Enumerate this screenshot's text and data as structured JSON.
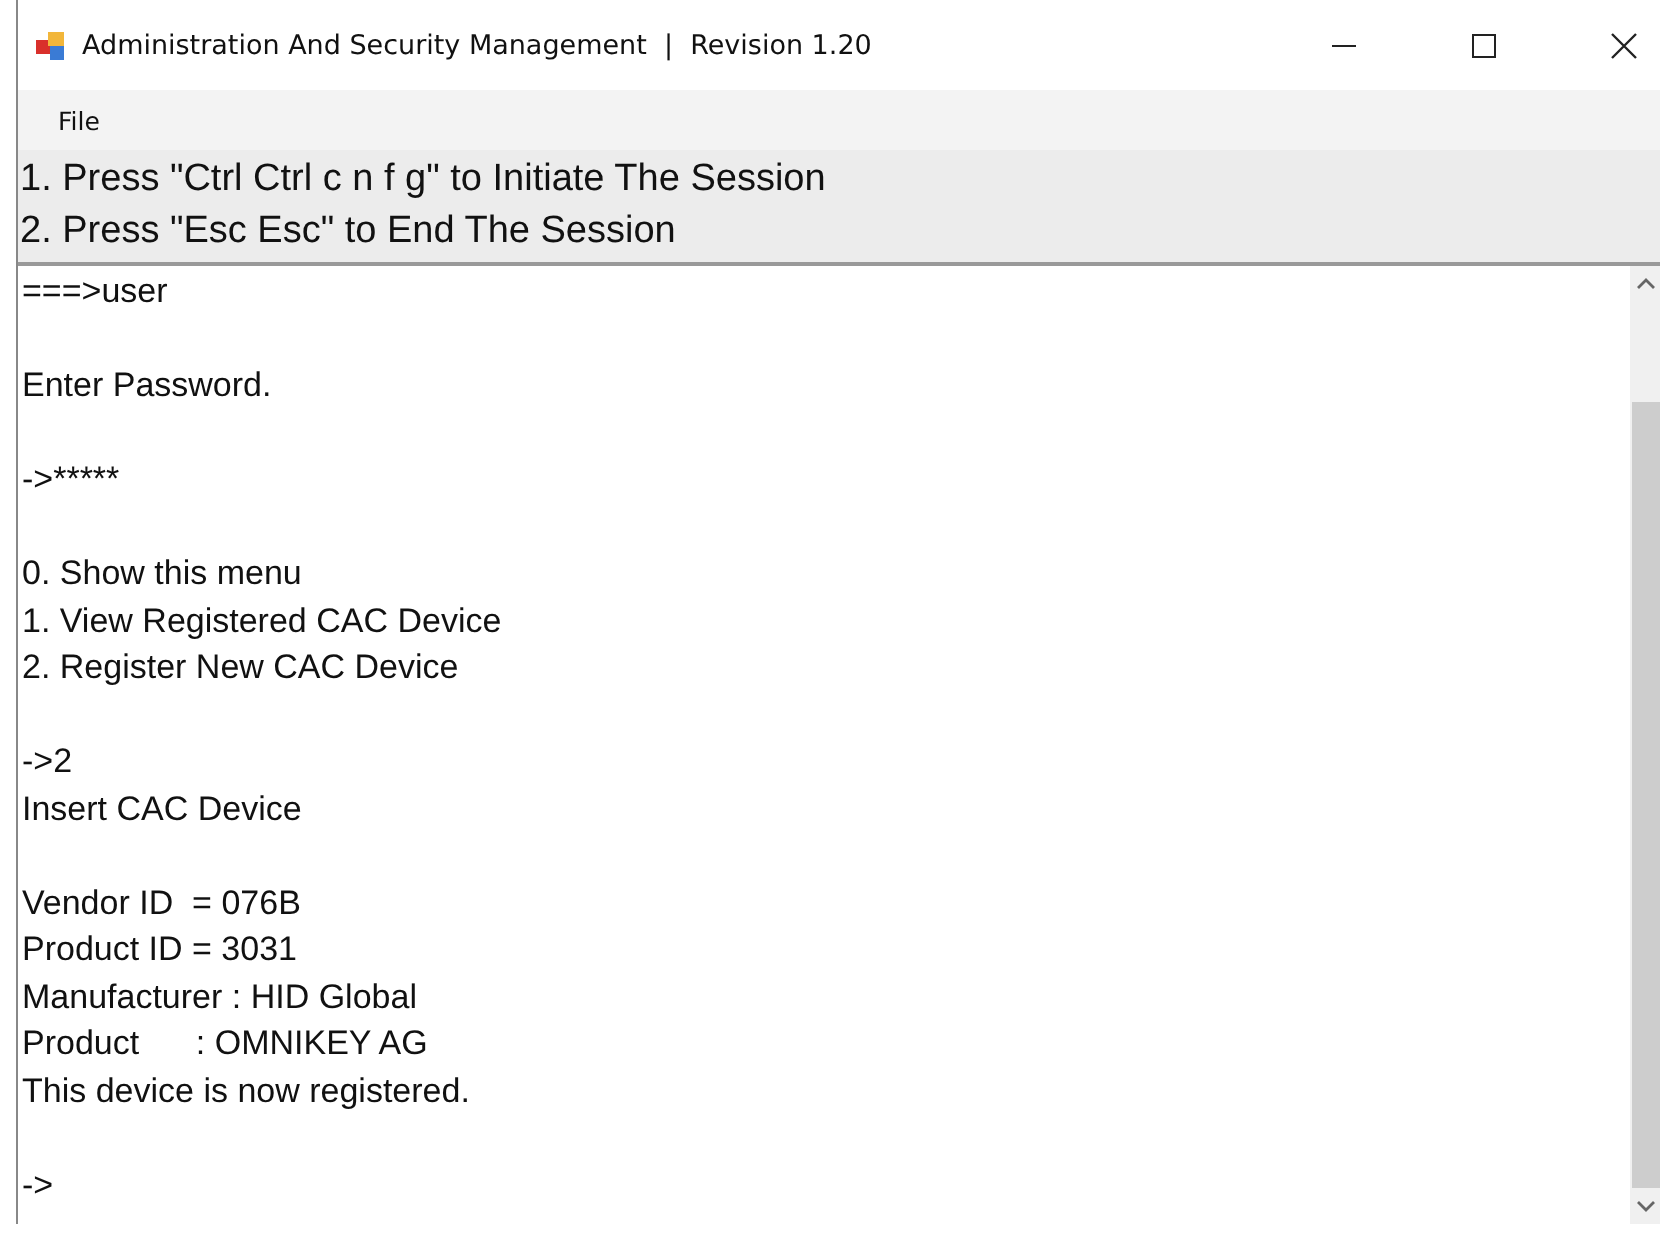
{
  "window": {
    "title": "Administration And Security Management  |  Revision 1.20"
  },
  "menu": [
    "File"
  ],
  "instructions": [
    "1. Press \"Ctrl Ctrl c n f g\" to Initiate The Session",
    "2. Press \"Esc Esc\" to End The Session"
  ],
  "console": {
    "blocks": [
      [
        "===>user"
      ],
      [
        "Enter Password."
      ],
      [
        "->*****"
      ],
      [
        "0. Show this menu",
        "1. View Registered CAC Device",
        "2. Register New CAC Device"
      ],
      [
        "->2",
        "Insert CAC Device"
      ],
      [
        "Vendor ID  = 076B",
        "Product ID = 3031",
        "Manufacturer : HID Global",
        "Product      : OMNIKEY AG",
        "This device is now registered."
      ],
      [
        "->"
      ]
    ]
  }
}
